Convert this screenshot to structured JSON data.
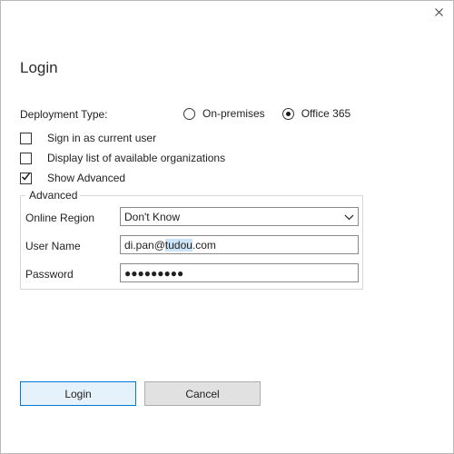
{
  "dialog": {
    "title": "Login"
  },
  "deployment": {
    "label": "Deployment Type:",
    "options": [
      {
        "label": "On-premises",
        "selected": false
      },
      {
        "label": "Office 365",
        "selected": true
      }
    ]
  },
  "checkboxes": [
    {
      "label": "Sign in as current user",
      "checked": false
    },
    {
      "label": "Display list of available organizations",
      "checked": false
    },
    {
      "label": "Show Advanced",
      "checked": true
    }
  ],
  "advanced": {
    "legend": "Advanced",
    "online_region": {
      "label": "Online Region",
      "value": "Don't Know"
    },
    "user_name": {
      "label": "User Name",
      "value_prefix": "di.pan@",
      "value_selected": "tudou",
      "value_suffix": ".com"
    },
    "password": {
      "label": "Password",
      "masked": "●●●●●●●●●"
    }
  },
  "buttons": {
    "login": {
      "mnemonic": "L",
      "rest": "ogin"
    },
    "cancel": {
      "mnemonic": "C",
      "rest": "ancel"
    }
  }
}
